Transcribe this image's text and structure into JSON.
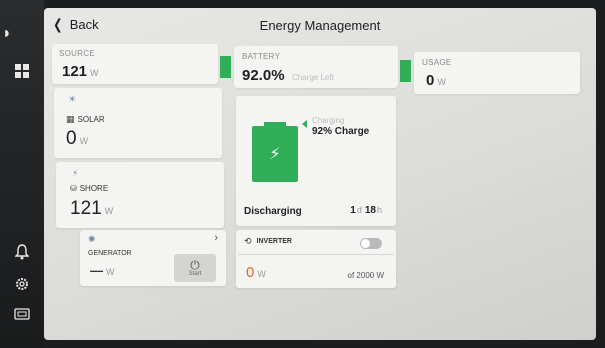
{
  "header": {
    "back_label": "Back",
    "title": "Energy Management"
  },
  "source": {
    "label": "SOURCE",
    "value": "121",
    "unit": "W"
  },
  "battery": {
    "label": "BATTERY",
    "percent": "92.0%",
    "charge_left_label": "Charge Left",
    "charging_label": "Charging",
    "charge_text": "92%  Charge",
    "discharging_label": "Discharging",
    "time_days": "1",
    "time_days_unit": "d",
    "time_hours": "18",
    "time_hours_unit": "h"
  },
  "usage": {
    "label": "USAGE",
    "value": "0",
    "unit": "W"
  },
  "solar": {
    "label": "SOLAR",
    "value": "0",
    "unit": "W"
  },
  "shore": {
    "label": "SHORE",
    "value": "121",
    "unit": "W"
  },
  "generator": {
    "label": "GENERATOR",
    "value": "—",
    "unit": "W",
    "start_label": "Start"
  },
  "inverter": {
    "label": "INVERTER",
    "value": "0",
    "unit": "W",
    "capacity": "of 2000 W",
    "enabled": false
  },
  "colors": {
    "accent": "#2fae57",
    "inverter_value": "#e06a2a"
  },
  "icons": [
    "chevron-left-icon",
    "grid-icon",
    "bell-icon",
    "gear-icon",
    "display-icon",
    "sun-icon",
    "solar-panel-icon",
    "plug-icon",
    "generator-icon",
    "lightning-icon",
    "power-icon",
    "inverter-icon",
    "chevron-right-icon"
  ]
}
